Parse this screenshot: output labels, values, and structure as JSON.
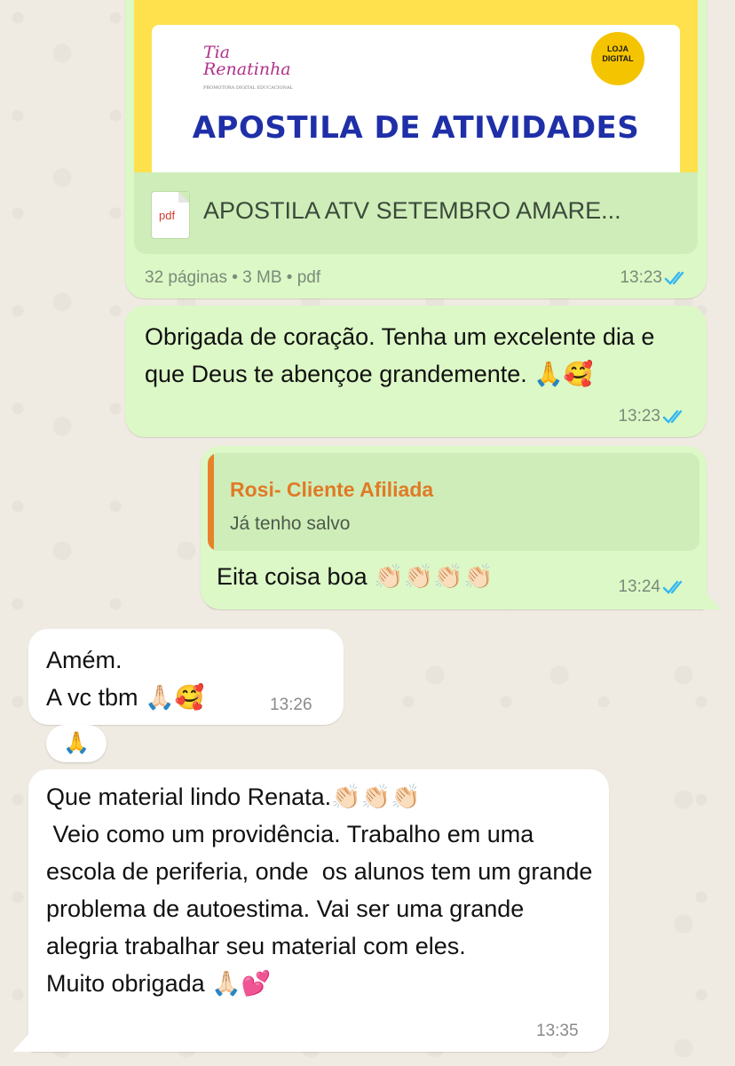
{
  "document_message": {
    "preview": {
      "brand_name": "Tia Renatinha",
      "brand_sub": "PROMOTORA DIGITAL EDUCACIONAL",
      "badge": "LOJA DIGITAL",
      "title": "APOSTILA DE ATIVIDADES"
    },
    "file_type_label": "pdf",
    "file_name": "APOSTILA ATV SETEMBRO AMARE...",
    "meta": "32 páginas • 3 MB • pdf",
    "time": "13:23"
  },
  "messages": [
    {
      "id": "msg2",
      "direction": "outgoing",
      "text": "Obrigada de coração. Tenha um excelente dia e que Deus te abençoe grandemente. 🙏🥰",
      "time": "13:23"
    },
    {
      "id": "msg3",
      "direction": "outgoing",
      "quote_author": "Rosi- Cliente Afiliada",
      "quote_text": "Já tenho salvo",
      "text": "Eita coisa boa 👏🏻👏🏻👏🏻👏🏻",
      "time": "13:24"
    },
    {
      "id": "msg4",
      "direction": "incoming",
      "text": "Amém.\nA vc tbm 🙏🏻🥰",
      "time": "13:26",
      "reaction": "🙏"
    },
    {
      "id": "msg5",
      "direction": "incoming",
      "text": "Que material lindo Renata.👏🏻👏🏻👏🏻\n Veio como um providência. Trabalho em uma escola de periferia, onde  os alunos tem um grande problema de autoestima. Vai ser uma grande alegria trabalhar seu material com eles.\nMuito obrigada 🙏🏻💕",
      "time": "13:35"
    }
  ],
  "colors": {
    "outgoing": "#DCF8C6",
    "incoming": "#FFFFFF",
    "read_ticks": "#34B7F1",
    "quote_author": "#E07A26"
  }
}
